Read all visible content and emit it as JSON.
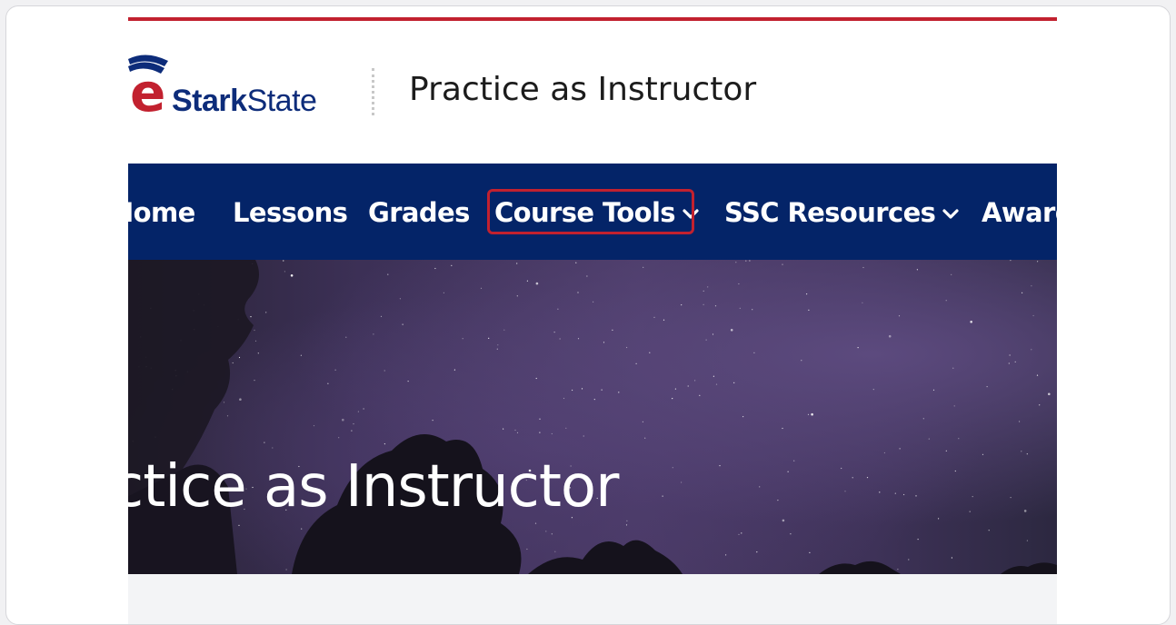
{
  "brand": {
    "logo_letter": "e",
    "logo_bold": "Stark",
    "logo_light": "State",
    "accent_color": "#c2212f",
    "brand_blue": "#0d2c7a"
  },
  "header": {
    "course_title": "Practice as Instructor"
  },
  "navbar": {
    "background": "#042468",
    "items": [
      {
        "label": "Home",
        "dropdown": false
      },
      {
        "label": "Lessons",
        "dropdown": false
      },
      {
        "label": "Grades",
        "dropdown": false
      },
      {
        "label": "Course Tools",
        "dropdown": true,
        "highlighted": true
      },
      {
        "label": "SSC Resources",
        "dropdown": true
      },
      {
        "label": "Awards",
        "dropdown": false
      }
    ]
  },
  "hero": {
    "title": "Practice as Instructor"
  }
}
